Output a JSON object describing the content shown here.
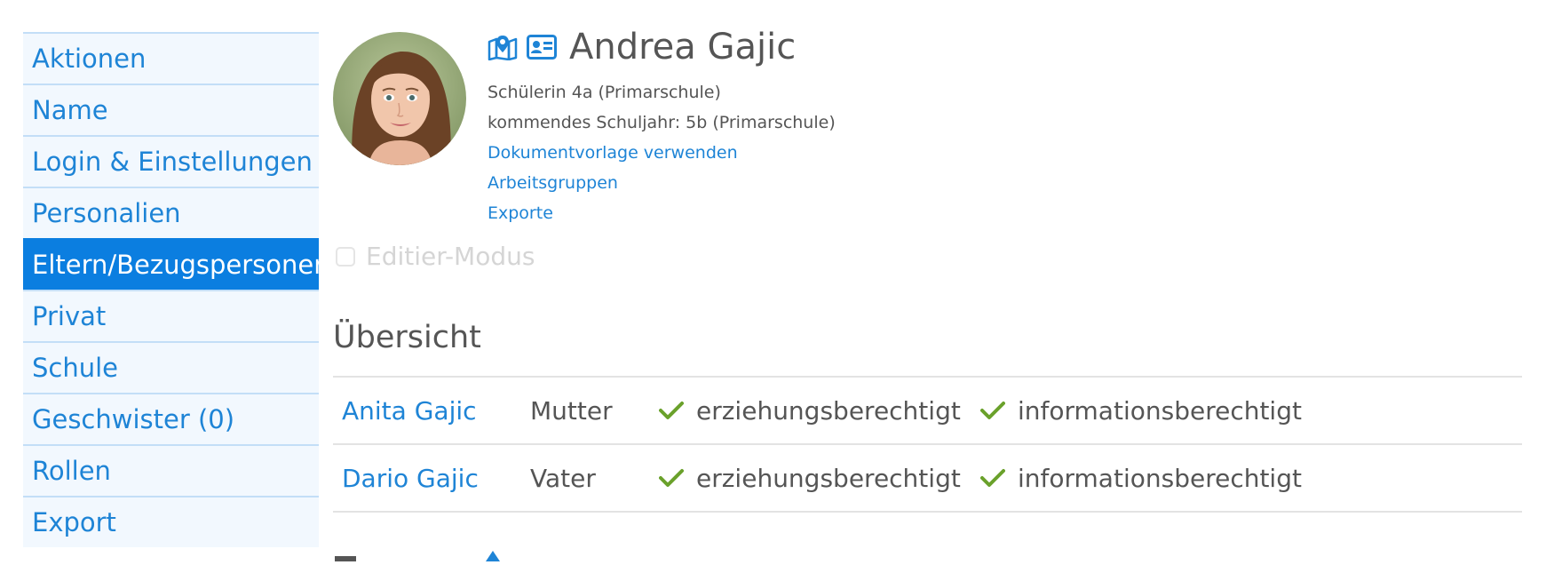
{
  "sidebar": {
    "items": [
      {
        "label": "Aktionen",
        "active": false
      },
      {
        "label": "Name",
        "active": false
      },
      {
        "label": "Login & Einstellungen",
        "active": false
      },
      {
        "label": "Personalien",
        "active": false
      },
      {
        "label": "Eltern/Bezugspersonen",
        "active": true
      },
      {
        "label": "Privat",
        "active": false
      },
      {
        "label": "Schule",
        "active": false
      },
      {
        "label": "Geschwister (0)",
        "active": false
      },
      {
        "label": "Rollen",
        "active": false
      },
      {
        "label": "Export",
        "active": false
      }
    ]
  },
  "person": {
    "name": "Andrea Gajic",
    "class_line": "Schülerin 4a (Primarschule)",
    "next_year_line": "kommendes Schuljahr: 5b (Primarschule)",
    "links": {
      "template": "Dokumentvorlage verwenden",
      "groups": "Arbeitsgruppen",
      "exports": "Exporte"
    },
    "icons": [
      "map-marker-icon",
      "id-card-icon"
    ]
  },
  "edit_mode": {
    "label": "Editier-Modus",
    "checked": false,
    "enabled": false
  },
  "overview": {
    "title": "Übersicht",
    "rows": [
      {
        "name": "Anita Gajic",
        "relation": "Mutter",
        "perm1": "erziehungsberechtigt",
        "perm2": "informationsberechtigt"
      },
      {
        "name": "Dario Gajic",
        "relation": "Vater",
        "perm1": "erziehungsberechtigt",
        "perm2": "informationsberechtigt"
      }
    ]
  },
  "colors": {
    "link": "#1e84d6",
    "active_nav": "#0b7ee0",
    "nav_bg": "#f2f8fe",
    "check": "#6aa12b"
  }
}
